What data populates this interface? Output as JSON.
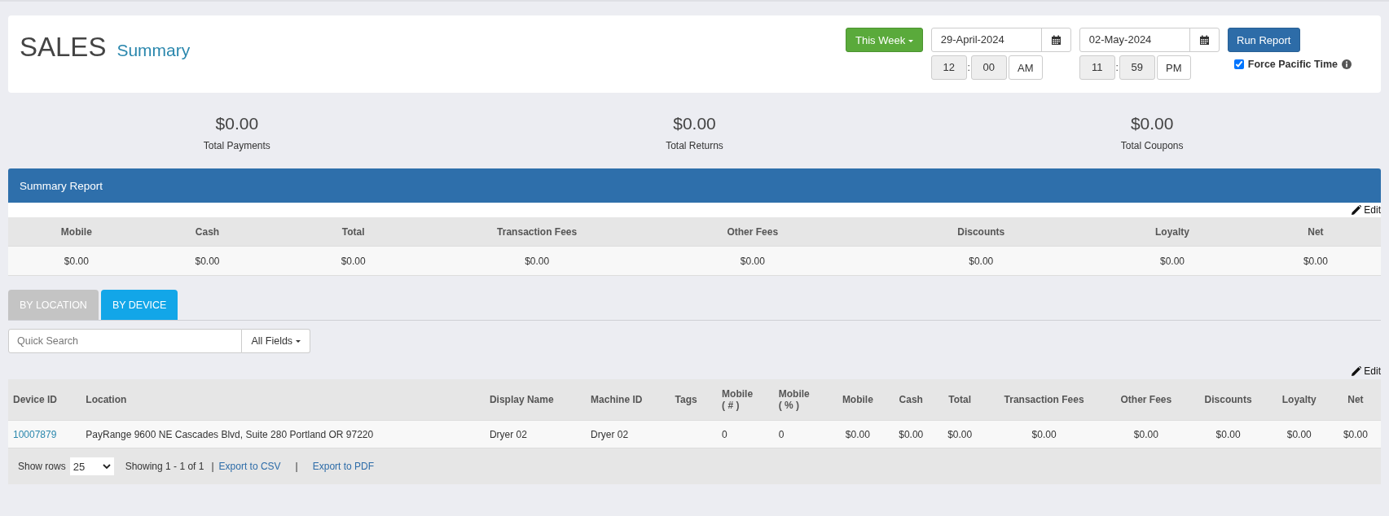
{
  "header": {
    "title": "SALES",
    "subtitle": "Summary",
    "range_button": "This Week",
    "start": {
      "date": "29-April-2024",
      "hour": "12",
      "separator": ":",
      "minute": "00",
      "period": "AM"
    },
    "end": {
      "date": "02-May-2024",
      "hour": "11",
      "separator": ":",
      "minute": "59",
      "period": "PM"
    },
    "run_button": "Run Report",
    "force_pacific": {
      "label": "Force Pacific Time",
      "checked": true
    }
  },
  "totals": [
    {
      "value": "$0.00",
      "label": "Total Payments"
    },
    {
      "value": "$0.00",
      "label": "Total Returns"
    },
    {
      "value": "$0.00",
      "label": "Total Coupons"
    }
  ],
  "summary_report": {
    "title": "Summary Report",
    "edit": "Edit",
    "columns": [
      "Mobile",
      "Cash",
      "Total",
      "Transaction Fees",
      "Other Fees",
      "Discounts",
      "Loyalty",
      "Net"
    ],
    "rows": [
      [
        "$0.00",
        "$0.00",
        "$0.00",
        "$0.00",
        "$0.00",
        "$0.00",
        "$0.00",
        "$0.00"
      ]
    ]
  },
  "tabs": [
    {
      "label": "BY LOCATION",
      "selected": false
    },
    {
      "label": "BY DEVICE",
      "selected": true
    }
  ],
  "search": {
    "placeholder": "Quick Search",
    "field_filter": "All Fields"
  },
  "device_table": {
    "edit": "Edit",
    "columns": [
      "Device ID",
      "Location",
      "Display Name",
      "Machine ID",
      "Tags",
      "Mobile\n( # )",
      "Mobile\n( % )",
      "Mobile",
      "Cash",
      "Total",
      "Transaction Fees",
      "Other Fees",
      "Discounts",
      "Loyalty",
      "Net"
    ],
    "rows": [
      [
        "10007879",
        "PayRange 9600 NE Cascades Blvd, Suite 280 Portland OR 97220",
        "Dryer 02",
        "Dryer 02",
        "",
        "0",
        "0",
        "$0.00",
        "$0.00",
        "$0.00",
        "$0.00",
        "$0.00",
        "$0.00",
        "$0.00",
        "$0.00"
      ]
    ],
    "footer": {
      "show_rows_label": "Show rows",
      "rows_value": "25",
      "showing": "Showing 1 - 1 of 1",
      "separator_1": "|",
      "export_csv": "Export to CSV",
      "separator_2": "|",
      "export_pdf": "Export to PDF"
    }
  }
}
